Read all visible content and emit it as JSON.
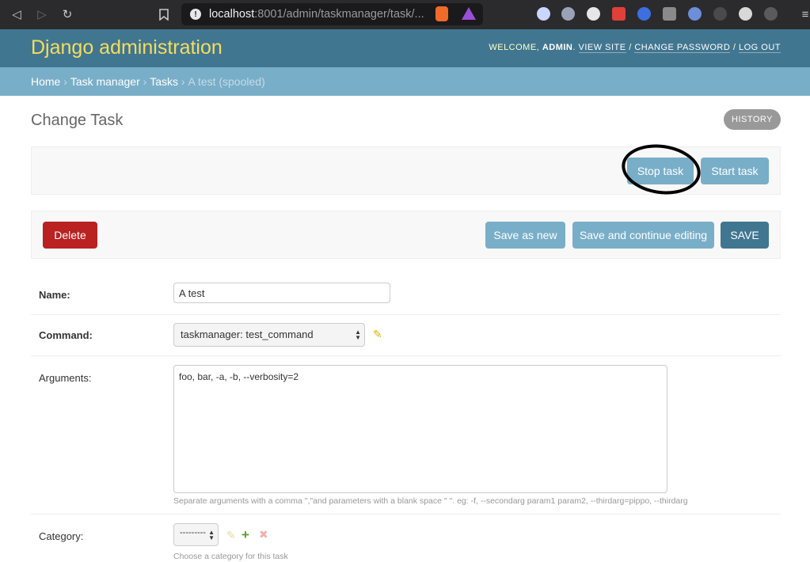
{
  "browser": {
    "url_host": "localhost",
    "url_rest": ":8001/admin/taskmanager/task/..."
  },
  "header": {
    "site_name": "Django administration",
    "welcome": "Welcome,",
    "user": "admin",
    "view_site": "View site",
    "change_password": "Change password",
    "log_out": "Log out",
    "sep": "/"
  },
  "breadcrumbs": {
    "home": "Home",
    "app": "Task manager",
    "model": "Tasks",
    "current": "A test (spooled)",
    "sep": "›"
  },
  "page": {
    "title": "Change Task",
    "history": "History"
  },
  "object_tools": {
    "stop": "Stop task",
    "start": "Start task"
  },
  "submit_row": {
    "delete": "Delete",
    "save_as_new": "Save as new",
    "save_continue": "Save and continue editing",
    "save": "SAVE"
  },
  "form": {
    "name": {
      "label": "Name:",
      "value": "A test"
    },
    "command": {
      "label": "Command:",
      "value": "taskmanager: test_command"
    },
    "arguments": {
      "label": "Arguments:",
      "value": "foo, bar, -a, -b, --verbosity=2",
      "help": "Separate arguments with a comma \",\"and parameters with a blank space \" \". eg: -f, --secondarg param1 param2, --thirdarg=pippo, --thirdarg"
    },
    "category": {
      "label": "Category:",
      "value": "---------",
      "help": "Choose a category for this task"
    }
  },
  "colors": {
    "header_bg": "#417690",
    "breadcrumbs_bg": "#79aec8",
    "site_name": "#f5dd5d",
    "delete_bg": "#ba2121"
  }
}
